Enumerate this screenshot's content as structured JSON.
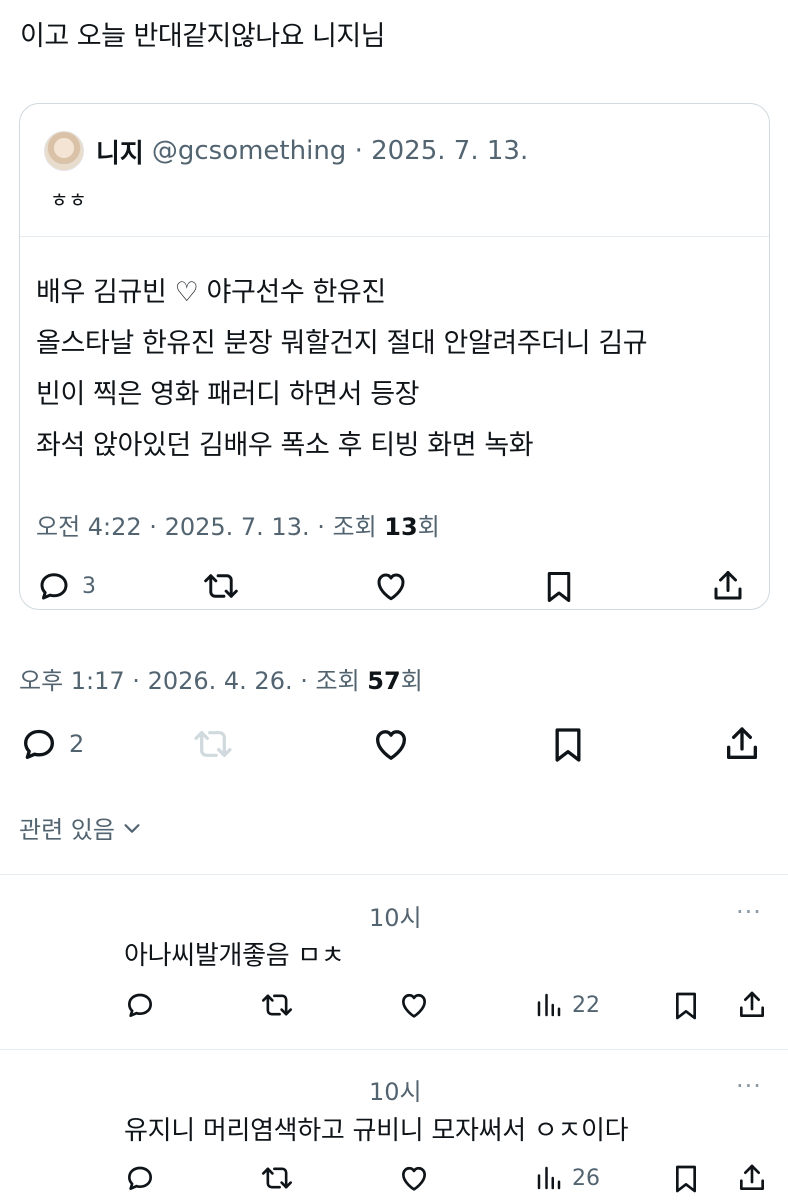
{
  "tweet": {
    "text": "이고 오늘 반대같지않나요 니지님"
  },
  "quote": {
    "author_name": "니지",
    "author_handle": "@gcsomething · 2025. 7. 13.",
    "short_text": "ㅎㅎ",
    "body_lines": [
      "배우 김규빈 ♡ 야구선수 한유진",
      "올스타날 한유진 분장 뭐할건지 절대 안알려주더니 김규",
      "빈이 찍은 영화 패러디 하면서 등장",
      "좌석 앉아있던 김배우 폭소 후 티빙 화면 녹화"
    ],
    "meta_prefix": "오전 4:22 · 2025. 7. 13. · 조회 ",
    "views": "13",
    "views_suffix": "회",
    "reply_count": "3"
  },
  "main_meta": {
    "prefix": "오후 1:17 · 2026. 4. 26. · 조회 ",
    "views": "57",
    "suffix": "회"
  },
  "main_actions": {
    "reply_count": "2"
  },
  "related": {
    "label": "관련 있음"
  },
  "replies": [
    {
      "time": "10시",
      "more": "···",
      "text": "아나씨발개좋음 ㅁㅊ",
      "views": "22"
    },
    {
      "time": "10시",
      "more": "···",
      "text": "유지니 머리염색하고 규비니 모자써서 ㅇㅈ이다",
      "views": "26"
    }
  ],
  "colors": {
    "text": "#0f1419",
    "muted": "#536471",
    "disabled": "#cfd9de",
    "border": "#cfd9de"
  },
  "icons": {
    "reply": "reply-icon",
    "retweet": "retweet-icon",
    "like": "heart-icon",
    "bookmark": "bookmark-icon",
    "share": "share-icon",
    "views": "views-chart-icon",
    "chevron": "chevron-down-icon"
  }
}
